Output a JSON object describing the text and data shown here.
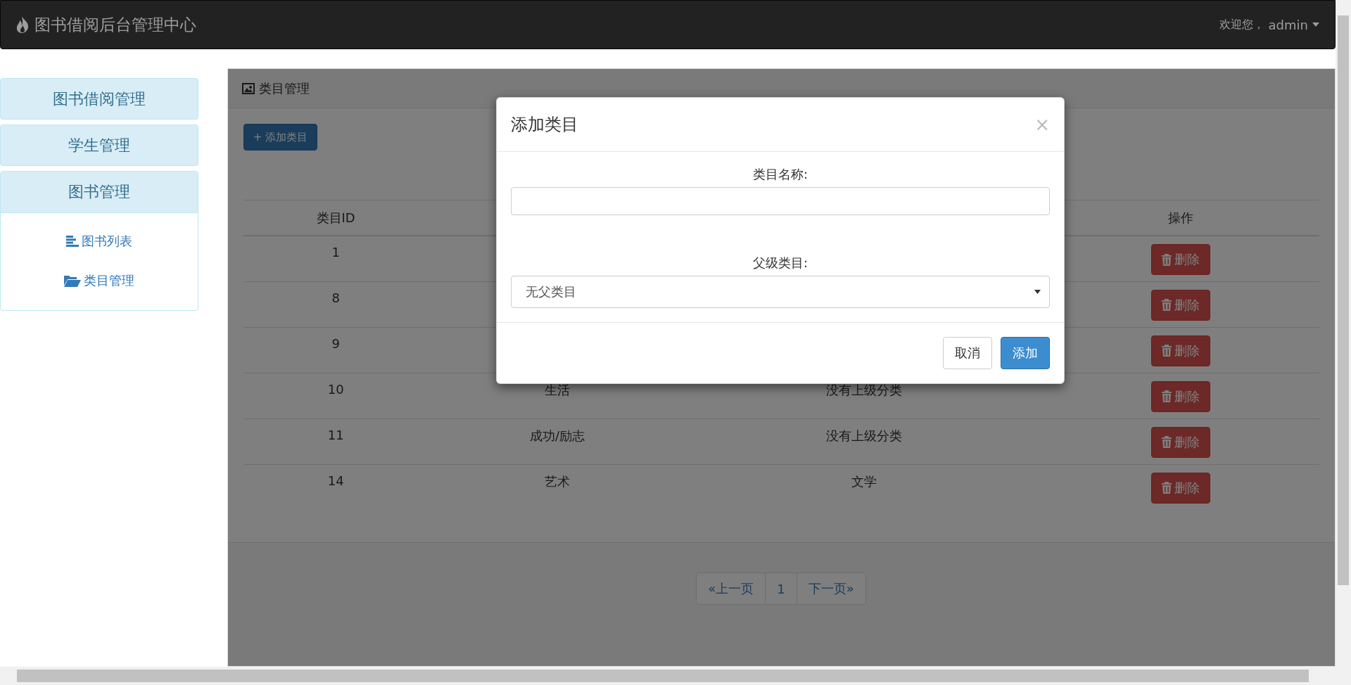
{
  "navbar": {
    "brand": "图书借阅后台管理中心",
    "welcome": "欢迎您，",
    "user": "admin"
  },
  "sidebar": {
    "items": [
      {
        "label": "图书借阅管理",
        "expanded": false
      },
      {
        "label": "学生管理",
        "expanded": false
      },
      {
        "label": "图书管理",
        "expanded": true,
        "children": [
          {
            "label": "图书列表",
            "kind": "list"
          },
          {
            "label": "类目管理",
            "kind": "folder"
          }
        ]
      }
    ]
  },
  "panel": {
    "title": "类目管理",
    "add_button": "+ 添加类目",
    "table": {
      "header": {
        "column_1": "类目ID",
        "column_4": "操作"
      },
      "rows": [
        {
          "column_1": "1",
          "column_4": "删除"
        },
        {
          "column_1": "8",
          "column_4": "删除"
        },
        {
          "column_1": "9",
          "column_4": "删除"
        },
        {
          "column_1": "10",
          "column_2": "生活",
          "column_3": "没有上级分类",
          "column_4": "删除"
        },
        {
          "column_1": "11",
          "column_2": "成功/励志",
          "column_3": "没有上级分类",
          "column_4": "删除"
        },
        {
          "column_1": "14",
          "column_2": "艺术",
          "column_3": "文学",
          "column_4": "删除"
        }
      ]
    },
    "pagination": [
      "«上一页",
      "1",
      "下一页»"
    ]
  },
  "modal": {
    "title": "添加类目",
    "close": "×",
    "name_label": "类目名称:",
    "parent_label": "父级类目:",
    "parent_value": "无父类目",
    "buttons": [
      {
        "label": "取消",
        "kind": "default"
      },
      {
        "label": "添加",
        "kind": "primary"
      }
    ]
  }
}
